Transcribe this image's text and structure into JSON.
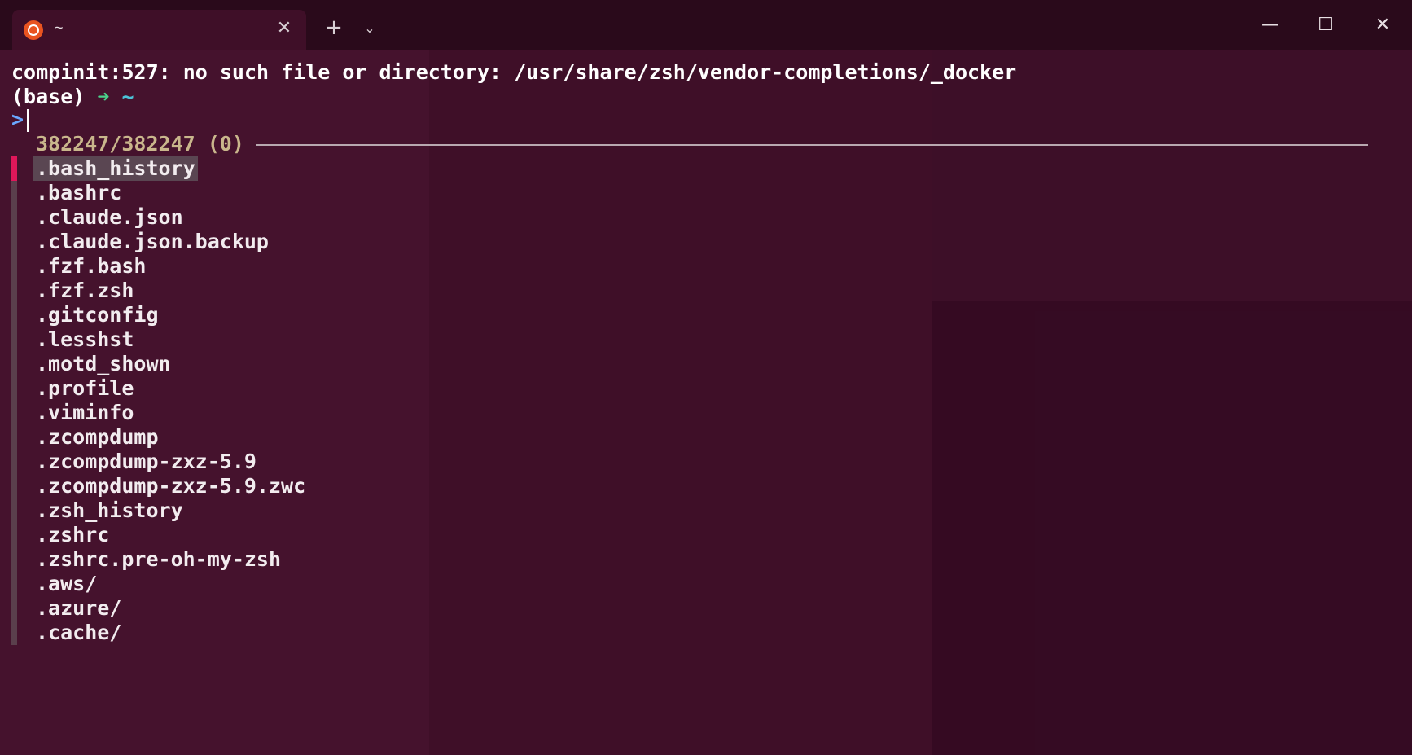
{
  "titlebar": {
    "tab_title": "~",
    "tab_close": "✕",
    "new_tab": "+",
    "dropdown": "⌄",
    "minimize": "—",
    "maximize": "☐",
    "close": "✕"
  },
  "terminal": {
    "error_line": "compinit:527: no such file or directory: /usr/share/zsh/vendor-completions/_docker",
    "prompt_env": "(base)",
    "prompt_arrow": "➜",
    "prompt_dir": "~",
    "input_caret": ">",
    "input_value": "",
    "match_count": "382247/382247 (0)",
    "results": [
      ".bash_history",
      ".bashrc",
      ".claude.json",
      ".claude.json.backup",
      ".fzf.bash",
      ".fzf.zsh",
      ".gitconfig",
      ".lesshst",
      ".motd_shown",
      ".profile",
      ".viminfo",
      ".zcompdump",
      ".zcompdump-zxz-5.9",
      ".zcompdump-zxz-5.9.zwc",
      ".zsh_history",
      ".zshrc",
      ".zshrc.pre-oh-my-zsh",
      ".aws/",
      ".azure/",
      ".cache/"
    ]
  },
  "colors": {
    "background": "#3f0f28",
    "selection_marker": "#e0175a",
    "prompt_green": "#4ad08a",
    "prompt_cyan": "#4cc3d8",
    "count_color": "#c9b68c",
    "ubuntu_orange": "#e95420"
  },
  "icons": {
    "tab_logo": "ubuntu-logo-icon",
    "close": "close-icon",
    "add": "plus-icon",
    "dropdown": "chevron-down-icon"
  }
}
